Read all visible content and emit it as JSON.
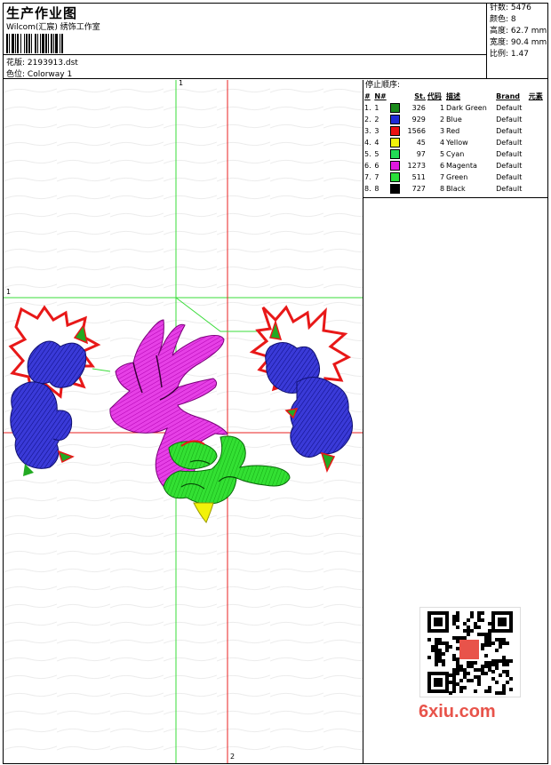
{
  "header": {
    "title": "生产作业图",
    "company": "Wilcom(汇宸) 绣饰工作室",
    "file_label": "花版:",
    "file_value": "2193913.dst",
    "colorway_label": "色位:",
    "colorway_value": "Colorway 1"
  },
  "stats": {
    "stitches": "针数: 5476",
    "colors": "颜色: 8",
    "height": "高度: 62.7 mm",
    "width": "宽度: 90.4 mm",
    "ratio": "比例: 1.47"
  },
  "sequence": {
    "label": "停止顺序:",
    "headers": [
      "#",
      "N#",
      "St.",
      "代码",
      "描述",
      "Brand",
      "元素"
    ],
    "rows": [
      {
        "idx": "1.",
        "n": "1",
        "st": "326",
        "code": "1",
        "desc": "Dark Green",
        "brand": "Default",
        "color": "#1a8a1a"
      },
      {
        "idx": "2.",
        "n": "2",
        "st": "929",
        "code": "2",
        "desc": "Blue",
        "brand": "Default",
        "color": "#1f2bd6"
      },
      {
        "idx": "3.",
        "n": "3",
        "st": "1566",
        "code": "3",
        "desc": "Red",
        "brand": "Default",
        "color": "#ee1111"
      },
      {
        "idx": "4.",
        "n": "4",
        "st": "45",
        "code": "4",
        "desc": "Yellow",
        "brand": "Default",
        "color": "#f2f20a"
      },
      {
        "idx": "5.",
        "n": "5",
        "st": "97",
        "code": "5",
        "desc": "Cyan",
        "brand": "Default",
        "color": "#22dd55"
      },
      {
        "idx": "6.",
        "n": "6",
        "st": "1273",
        "code": "6",
        "desc": "Magenta",
        "brand": "Default",
        "color": "#e019e0"
      },
      {
        "idx": "7.",
        "n": "7",
        "st": "511",
        "code": "7",
        "desc": "Green",
        "brand": "Default",
        "color": "#2adf3a"
      },
      {
        "idx": "8.",
        "n": "8",
        "st": "727",
        "code": "8",
        "desc": "Black",
        "brand": "Default",
        "color": "#000000"
      }
    ]
  },
  "axes": {
    "v_green_top": "1",
    "h_green_left": "1",
    "v_red_bottom": "2"
  },
  "watermark": "6xiu.com"
}
